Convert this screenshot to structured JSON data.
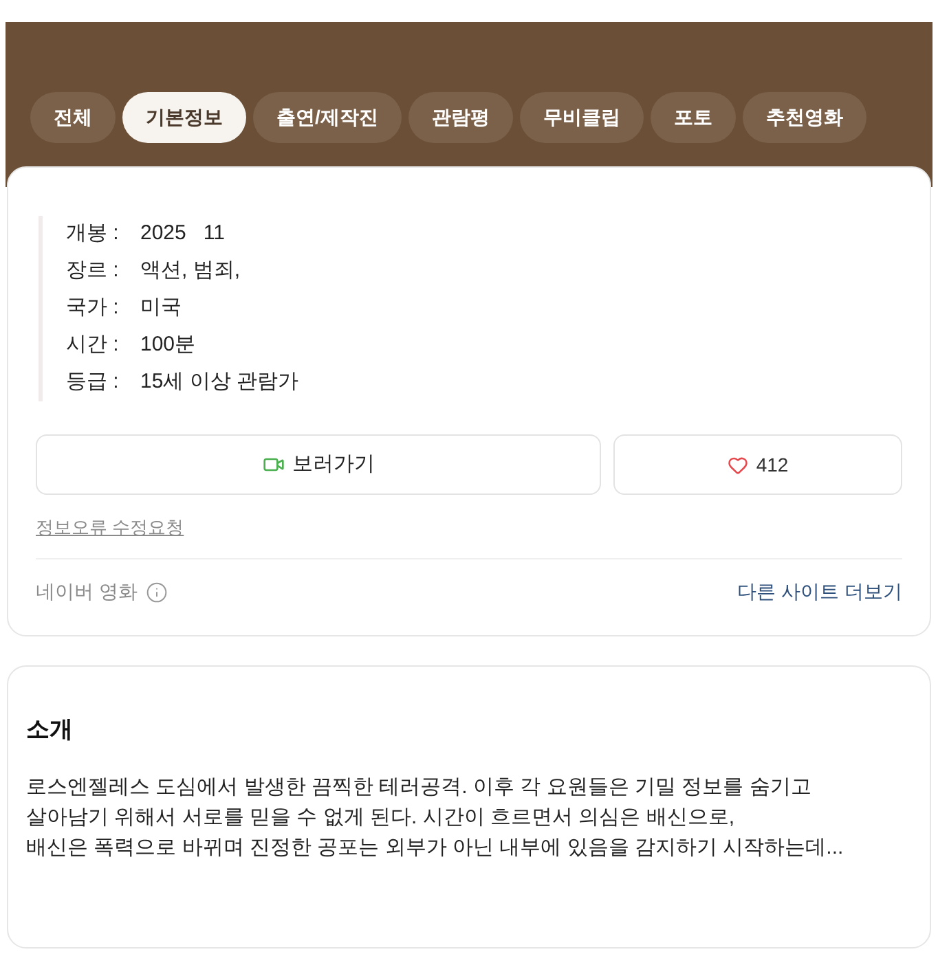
{
  "tabs": [
    {
      "label": "전체",
      "selected": false
    },
    {
      "label": "기본정보",
      "selected": true
    },
    {
      "label": "출연/제작진",
      "selected": false
    },
    {
      "label": "관람평",
      "selected": false
    },
    {
      "label": "무비클립",
      "selected": false
    },
    {
      "label": "포토",
      "selected": false
    },
    {
      "label": "추천영화",
      "selected": false
    }
  ],
  "info": {
    "rows": [
      {
        "label": "개봉 :",
        "value": "2025   11"
      },
      {
        "label": "장르 :",
        "value": "액션, 범죄,"
      },
      {
        "label": "국가 :",
        "value": "미국"
      },
      {
        "label": "시간 :",
        "value": "100분"
      },
      {
        "label": "등급 :",
        "value": "15세 이상 관람가"
      }
    ]
  },
  "actions": {
    "watch": {
      "label": "보러가기"
    },
    "like": {
      "count": "412"
    }
  },
  "report_link": "정보오류 수정요청",
  "footer": {
    "source": "네이버 영화",
    "more_link": "다른 사이트 더보기"
  },
  "synopsis": {
    "title": "소개",
    "text": "로스엔젤레스 도심에서 발생한 끔찍한 테러공격. 이후 각 요원들은 기밀 정보를 숨기고\n살아남기 위해서 서로를 믿을 수 없게 된다. 시간이 흐르면서 의심은 배신으로,\n배신은 폭력으로 바뀌며 진정한 공포는 외부가 아닌 내부에 있음을 감지하기 시작하는데..."
  }
}
